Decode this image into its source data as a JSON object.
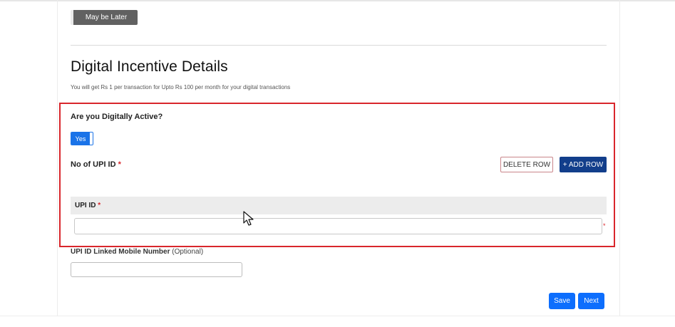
{
  "top": {
    "maybe_later_label": "May be Later"
  },
  "section": {
    "title": "Digital Incentive Details",
    "subtitle": "You will get Rs 1 per transaction for Upto Rs 100 per month for your digital transactions"
  },
  "digital_active": {
    "question": "Are you Digitally Active?",
    "toggle_value": "Yes"
  },
  "upi_count": {
    "label": "No of UPI ID",
    "required_mark": "*",
    "delete_row_label": "DELETE ROW",
    "add_row_label": "+ ADD ROW"
  },
  "upi_table": {
    "header_label": "UPI ID",
    "required_mark": "*",
    "input_value": "",
    "input_required_mark": "*"
  },
  "mobile": {
    "label": "UPI ID Linked Mobile Number",
    "optional": "(Optional)",
    "input_value": ""
  },
  "actions": {
    "save_label": "Save",
    "next_label": "Next"
  },
  "colors": {
    "highlight_border": "#d9262c",
    "primary": "#0d6efd",
    "add_row_bg": "#123e8b",
    "maybe_later_bg": "#616161"
  }
}
